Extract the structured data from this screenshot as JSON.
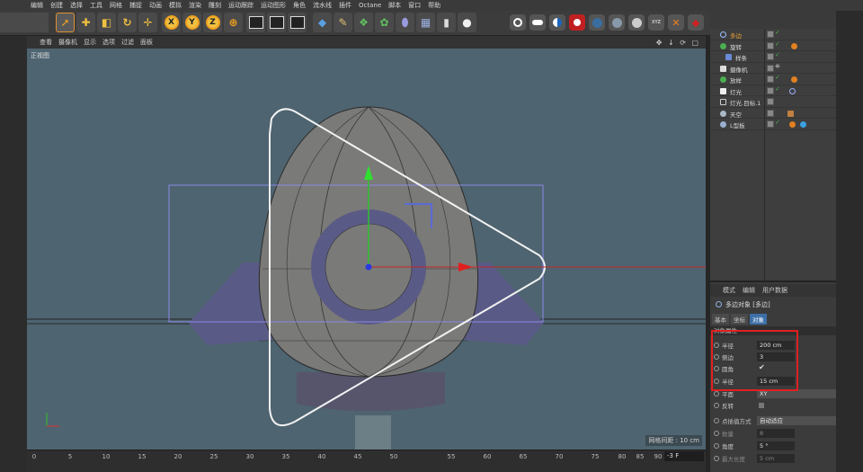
{
  "menu": [
    "编辑",
    "创建",
    "选择",
    "工具",
    "网格",
    "捕捉",
    "动画",
    "模拟",
    "渲染",
    "雕刻",
    "运动跟踪",
    "运动图形",
    "角色",
    "流水线",
    "插件",
    "Octane",
    "脚本",
    "窗口",
    "帮助"
  ],
  "toolbar": {
    "axis_x": "X",
    "axis_y": "Y",
    "axis_z": "Z"
  },
  "viewport_menu": [
    "查看",
    "摄像机",
    "显示",
    "选项",
    "过滤",
    "面板"
  ],
  "viewport": {
    "name": "正视图",
    "grid_spacing": "网格间距 : 10 cm",
    "bg_color": "#4e6470"
  },
  "timeline": {
    "ticks": [
      "0",
      "5",
      "10",
      "15",
      "20",
      "25",
      "30",
      "35",
      "40",
      "45",
      "50",
      "55",
      "60",
      "65",
      "70",
      "75",
      "80",
      "85",
      "90"
    ],
    "frame": "-3 F"
  },
  "objects": [
    {
      "name": "多边",
      "icon": "circle-spline-icon",
      "color": "#e8a030",
      "tag": ""
    },
    {
      "name": "旋转",
      "icon": "lathe-icon",
      "color": "#4caf50",
      "tag": ""
    },
    {
      "name": "样条",
      "icon": "spline-icon",
      "color": "#d8d8d8",
      "tag": ""
    },
    {
      "name": "摄像机",
      "icon": "camera-icon",
      "color": "#d8d8d8",
      "tag": "target-tag"
    },
    {
      "name": "放样",
      "icon": "loft-icon",
      "color": "#d8d8d8",
      "tag": "material-tag"
    },
    {
      "name": "灯光",
      "icon": "light-icon",
      "color": "#d8d8d8",
      "tag": "target-tag"
    },
    {
      "name": "灯光.目标.1",
      "icon": "null-icon",
      "color": "#d8d8d8",
      "tag": ""
    },
    {
      "name": "天空",
      "icon": "sky-icon",
      "color": "#d8d8d8",
      "tag": "texture-tag"
    },
    {
      "name": "L型板",
      "icon": "floor-icon",
      "color": "#d8d8d8",
      "tag": "material-tag"
    }
  ],
  "attributes": {
    "tabs": [
      "模式",
      "编辑",
      "用户数据"
    ],
    "title": "多边对象 [多边]",
    "subtabs": [
      "基本",
      "坐标",
      "对象"
    ],
    "section": "对象属性",
    "fields": [
      {
        "label": "半径",
        "value": "200 cm"
      },
      {
        "label": "侧边",
        "value": "3"
      },
      {
        "label": "圆角",
        "value": "✔"
      },
      {
        "label": "半径",
        "value": "15 cm"
      },
      {
        "label": "平面",
        "value": "XY"
      },
      {
        "label": "反转",
        "value": ""
      },
      {
        "label": "点插值方式",
        "value": "自动适应"
      },
      {
        "label": "数量",
        "value": "8"
      },
      {
        "label": "角度",
        "value": "5 °"
      },
      {
        "label": "最大长度",
        "value": "5 cm"
      }
    ]
  }
}
